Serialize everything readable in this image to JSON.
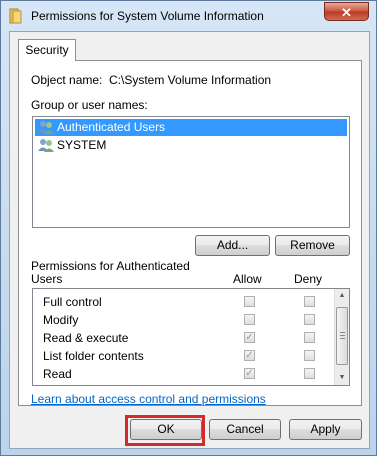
{
  "window": {
    "title": "Permissions for System Volume Information",
    "close_icon": "close-icon",
    "folder_icon": "folder-icon"
  },
  "tabs": [
    {
      "label": "Security",
      "active": true
    }
  ],
  "object": {
    "label": "Object name:",
    "value": "C:\\System Volume Information"
  },
  "groups": {
    "label": "Group or user names:",
    "items": [
      {
        "name": "Authenticated Users",
        "icon": "users-icon",
        "selected": true
      },
      {
        "name": "SYSTEM",
        "icon": "users-icon",
        "selected": false
      }
    ],
    "add_label": "Add...",
    "remove_label": "Remove"
  },
  "permissions": {
    "header_line1": "Permissions for Authenticated",
    "header_line2": "Users",
    "allow_label": "Allow",
    "deny_label": "Deny",
    "rows": [
      {
        "label": "Full control",
        "allow": false,
        "deny": false
      },
      {
        "label": "Modify",
        "allow": false,
        "deny": false
      },
      {
        "label": "Read & execute",
        "allow": true,
        "deny": false
      },
      {
        "label": "List folder contents",
        "allow": true,
        "deny": false
      },
      {
        "label": "Read",
        "allow": true,
        "deny": false
      }
    ]
  },
  "link_text": "Learn about access control and permissions",
  "footer": {
    "ok_label": "OK",
    "cancel_label": "Cancel",
    "apply_label": "Apply"
  },
  "colors": {
    "selection": "#3399ff",
    "link": "#0066cc",
    "highlight": "#d32b2b"
  }
}
